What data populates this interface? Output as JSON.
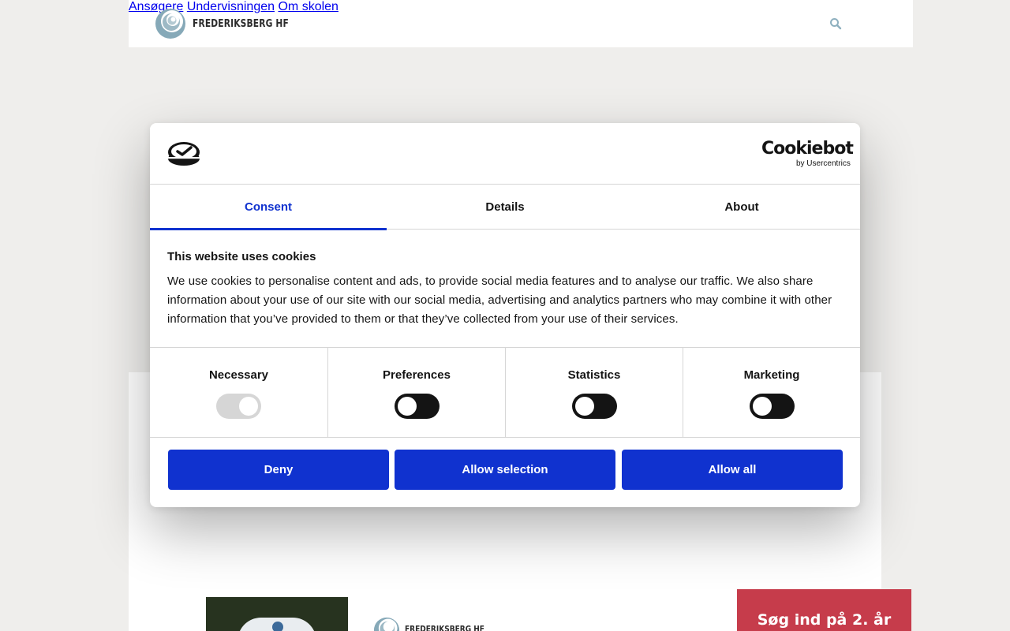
{
  "site": {
    "logo_text": "FREDERIKSBERG HF",
    "nav": [
      "Ansøgere",
      "Undervisningen",
      "Om skolen"
    ],
    "search_icon": "search-icon",
    "footer_logo_text": "FREDERIKSBERG HF",
    "cta_label": "Søg ind på 2. år",
    "colors": {
      "accent": "#7fa3b3",
      "cta": "#c63c4b",
      "background": "#efeeec"
    }
  },
  "cookie_dialog": {
    "brand": "Cookiebot",
    "brand_sub": "by Usercentrics",
    "tabs": [
      {
        "label": "Consent",
        "active": true
      },
      {
        "label": "Details",
        "active": false
      },
      {
        "label": "About",
        "active": false
      }
    ],
    "title": "This website uses cookies",
    "text": "We use cookies to personalise content and ads, to provide social media features and to analyse our traffic. We also share information about your use of our site with our social media, advertising and analytics partners who may combine it with other information that you’ve provided to them or that they’ve collected from your use of their services.",
    "categories": [
      {
        "label": "Necessary",
        "checked": true,
        "disabled": true
      },
      {
        "label": "Preferences",
        "checked": false,
        "disabled": false
      },
      {
        "label": "Statistics",
        "checked": false,
        "disabled": false
      },
      {
        "label": "Marketing",
        "checked": false,
        "disabled": false
      }
    ],
    "buttons": {
      "deny": "Deny",
      "allow_selection": "Allow selection",
      "allow_all": "Allow all"
    },
    "colors": {
      "primary": "#1032cf",
      "text": "#141414",
      "divider": "#d6d6d6"
    }
  }
}
